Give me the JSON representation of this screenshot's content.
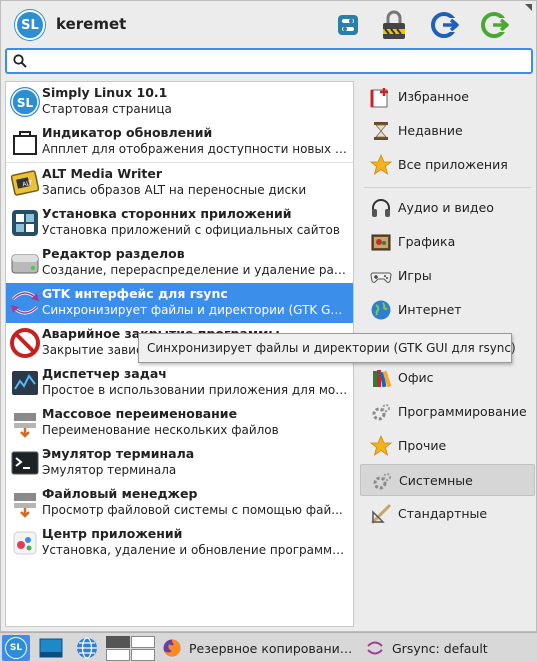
{
  "header": {
    "logo_text": "SL",
    "username": "keremet",
    "buttons": [
      "toggle-settings-icon",
      "lock-screen-icon",
      "logout-icon",
      "switch-user-icon"
    ]
  },
  "search": {
    "value": "",
    "placeholder": ""
  },
  "apps": [
    {
      "title": "Simply Linux 10.1",
      "desc": "Стартовая страница",
      "icon": "simply-linux-icon"
    },
    {
      "title": "Индикатор обновлений",
      "desc": "Апплет для отображения доступности новых пак...",
      "icon": "update-indicator-icon"
    },
    {
      "title": "ALT Media Writer",
      "desc": "Запись образов ALT на переносные диски",
      "icon": "media-writer-icon"
    },
    {
      "title": "Установка сторонних приложений",
      "desc": "Установка приложений с официальных сайтов",
      "icon": "third-party-apps-icon"
    },
    {
      "title": "Редактор разделов",
      "desc": "Создание, перераспределение и удаление разд...",
      "icon": "partition-editor-icon"
    },
    {
      "title": "GTK интерфейс для rsync",
      "desc": "Синхронизирует файлы и директории (GTK GUI...",
      "icon": "grsync-icon"
    },
    {
      "title": "Аварийное закрытие программы",
      "desc": "Закрытие зависших программ",
      "icon": "force-quit-icon"
    },
    {
      "title": "Диспетчер задач",
      "desc": "Простое в использовании приложения для мон...",
      "icon": "task-manager-icon"
    },
    {
      "title": "Массовое переименование",
      "desc": "Переименование нескольких файлов",
      "icon": "bulk-rename-icon"
    },
    {
      "title": "Эмулятор терминала",
      "desc": "Эмулятор терминала",
      "icon": "terminal-icon"
    },
    {
      "title": "Файловый менеджер",
      "desc": "Просмотр файловой системы с помощью фай...",
      "icon": "file-manager-icon"
    },
    {
      "title": "Центр приложений",
      "desc": "Установка, удаление и обновление программн...",
      "icon": "app-center-icon"
    }
  ],
  "categories": [
    {
      "label": "Избранное",
      "icon": "favorites-icon"
    },
    {
      "label": "Недавние",
      "icon": "recent-icon"
    },
    {
      "label": "Все приложения",
      "icon": "all-apps-icon"
    },
    {
      "label": "Аудио и видео",
      "icon": "audio-video-icon"
    },
    {
      "label": "Графика",
      "icon": "graphics-icon"
    },
    {
      "label": "Игры",
      "icon": "games-icon"
    },
    {
      "label": "Интернет",
      "icon": "internet-icon"
    },
    {
      "label": "Офис",
      "icon": "office-icon"
    },
    {
      "label": "Программирование",
      "icon": "programming-icon"
    },
    {
      "label": "Прочие",
      "icon": "other-icon"
    },
    {
      "label": "Системные",
      "icon": "system-icon"
    },
    {
      "label": "Стандартные",
      "icon": "accessories-icon"
    }
  ],
  "tooltip": "Синхронизирует файлы и директории (GTK GUI для rsync)",
  "taskbar": {
    "start_label": "SL",
    "window1": "Резервное копирование ...",
    "window2": "Grsync: default"
  },
  "colors": {
    "accent": "#3b8eea",
    "selected_category": "#d6d6d6"
  }
}
